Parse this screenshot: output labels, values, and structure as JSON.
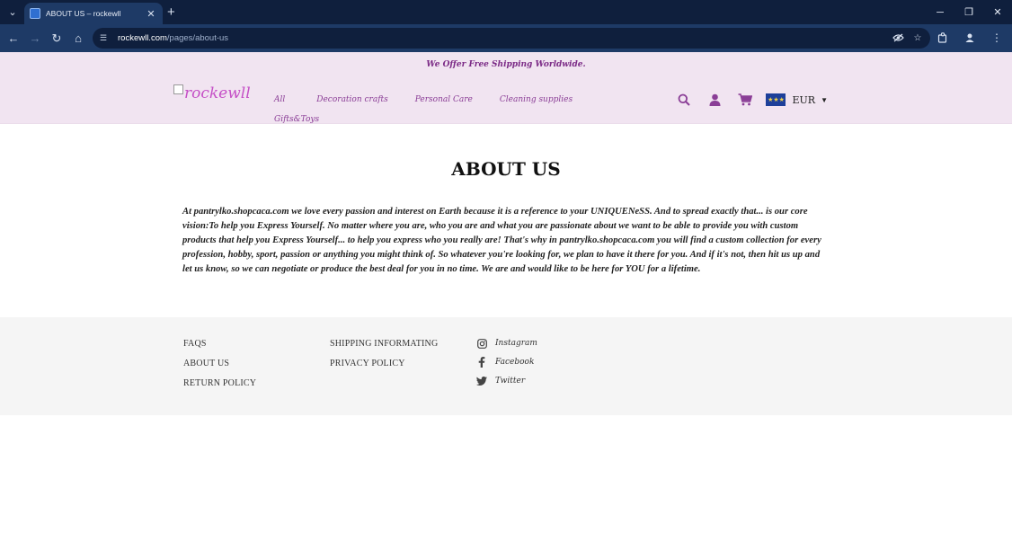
{
  "browser": {
    "tab_title": "ABOUT US – rockewll",
    "url_host": "rockewll.com",
    "url_path": "/pages/about-us"
  },
  "announcement": "We Offer Free Shipping Worldwide.",
  "header": {
    "logo_text": "rockewll",
    "nav": [
      "All",
      "Decoration crafts",
      "Personal Care",
      "Cleaning supplies",
      "Gifts&Toys"
    ],
    "currency": "EUR"
  },
  "page": {
    "title": "ABOUT US",
    "body": "At pantrylko.shopcaca.com we love every passion and interest on Earth because it is a reference to your UNIQUENeSS. And to spread exactly that... is our core vision:To help you Express Yourself. No matter where you are, who you are and what you are passionate about we want to be able to provide you with custom products that help you Express Yourself... to help you express who you really are! That's why in pantrylko.shopcaca.com you will find a custom collection for every profession, hobby, sport, passion or anything you might think of. So whatever you're looking for, we plan to have it there for you. And if it's not, then hit us up and let us know, so we can negotiate or produce the best deal for you in no time. We are and would like to be here for YOU for a lifetime."
  },
  "footer": {
    "col1": [
      "FAQS",
      "ABOUT US",
      "RETURN POLICY"
    ],
    "col2": [
      "SHIPPING INFORMATING",
      "PRIVACY POLICY"
    ],
    "social": [
      "Instagram",
      "Facebook",
      "Twitter"
    ]
  },
  "colors": {
    "brand": "#c54fc6",
    "nav_text": "#8a3d96",
    "header_bg": "#f1e4f1",
    "footer_bg": "#f5f5f5",
    "browser_dark": "#0f1f3d",
    "browser_toolbar": "#1e3a66"
  }
}
